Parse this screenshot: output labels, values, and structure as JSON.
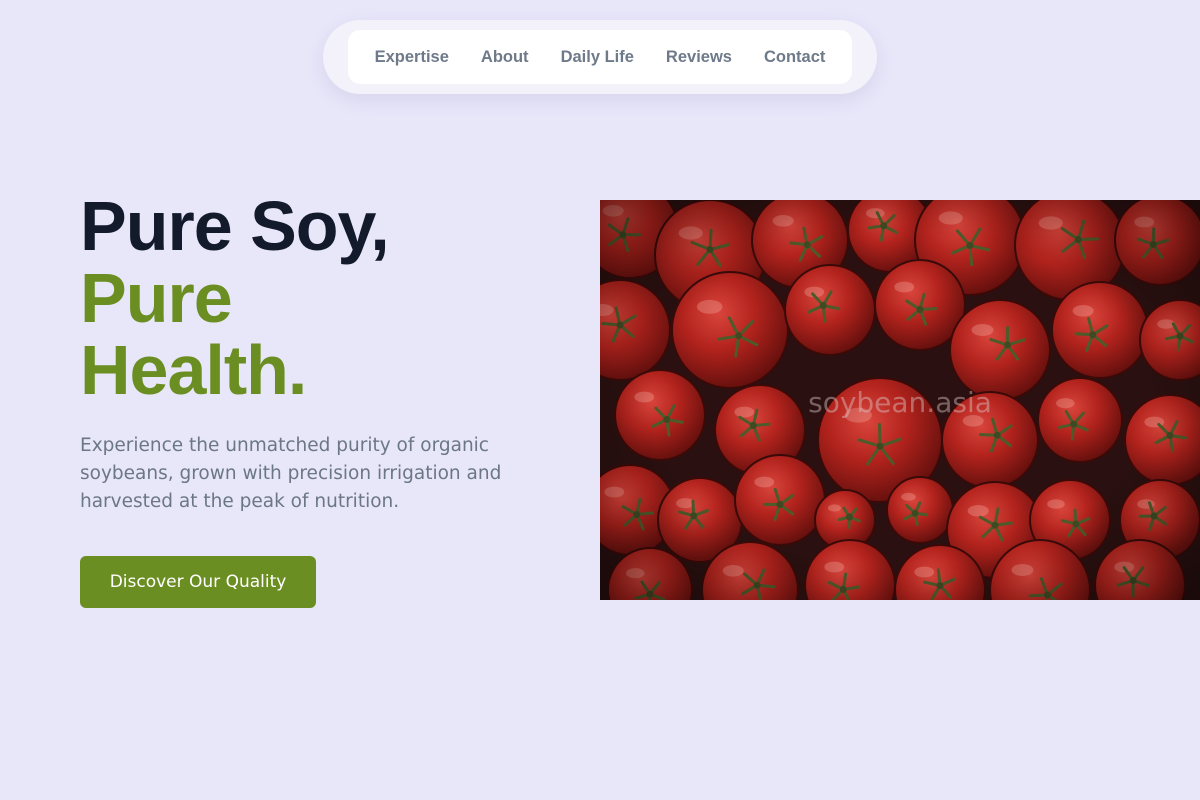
{
  "nav": {
    "items": [
      {
        "label": "Expertise"
      },
      {
        "label": "About"
      },
      {
        "label": "Daily Life"
      },
      {
        "label": "Reviews"
      },
      {
        "label": "Contact"
      }
    ]
  },
  "hero": {
    "title_line1": "Pure Soy,",
    "title_line2": "Pure",
    "title_line3": "Health.",
    "description": "Experience the unmatched purity of organic soybeans, grown with precision irrigation and harvested at the peak of nutrition.",
    "cta_label": "Discover Our Quality",
    "image": {
      "subject": "pile of red tomatoes",
      "watermark": "soybean.asia"
    }
  },
  "colors": {
    "background": "#e8e6f9",
    "accent_green": "#6b8e23",
    "title_dark": "#121a2c",
    "body_text": "#6b7785",
    "nav_text": "#6e7a8a"
  }
}
